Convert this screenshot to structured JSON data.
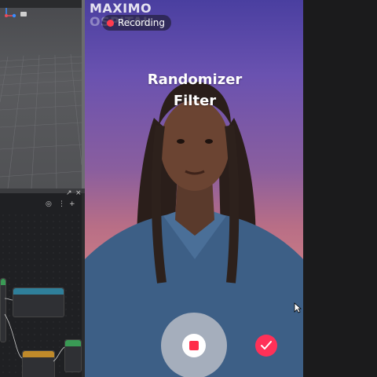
{
  "editor": {
    "viewport_label": "3D viewport",
    "toolbar_icons": [
      "scene-icon",
      "add-icon"
    ]
  },
  "camera": {
    "watermark_line1": "MAXIMO",
    "watermark_line2": "OSPITAL",
    "recording_label": "Recording",
    "filter_title_line1": "Randomizer",
    "filter_title_line2": "Filter"
  },
  "colors": {
    "record_dot": "#ff3b4e",
    "stop_square": "#ff2d4a",
    "confirm_button": "#ff3158"
  }
}
